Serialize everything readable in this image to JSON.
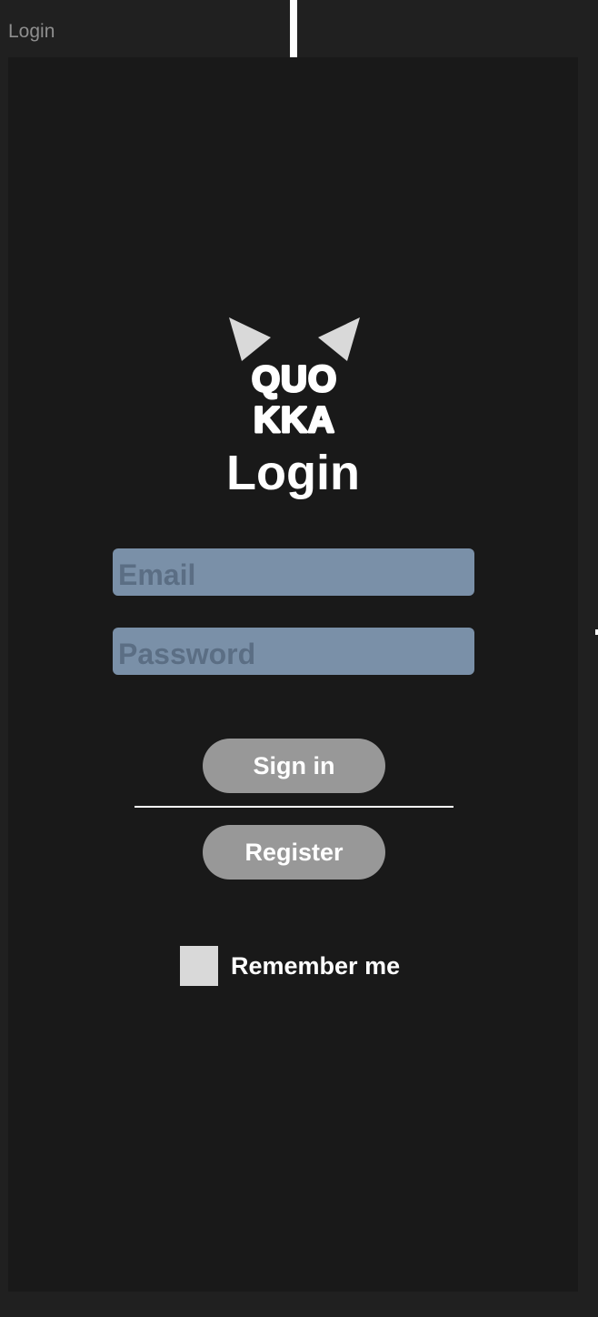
{
  "frame": {
    "label": "Login"
  },
  "logo": {
    "line1": "QUO",
    "line2": "KKA"
  },
  "login": {
    "title": "Login",
    "email_placeholder": "Email",
    "password_placeholder": "Password",
    "signin_label": "Sign in",
    "register_label": "Register",
    "remember_label": "Remember me",
    "remember_checked": false
  },
  "colors": {
    "canvas": "#202020",
    "screen": "#191919",
    "input_fill": "#7a90a8",
    "placeholder": "#5b6e84",
    "button_fill": "#989898",
    "checkbox_fill": "#d9d9d9",
    "text": "#ffffff"
  },
  "icons": {
    "logo": "quokka-logo-with-ears"
  }
}
